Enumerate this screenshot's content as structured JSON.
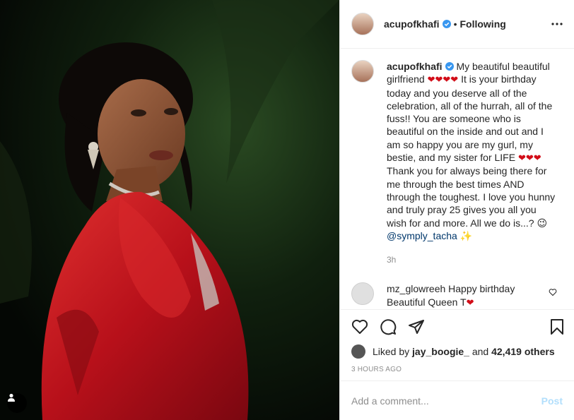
{
  "post": {
    "author": "acupofkhafi",
    "follow_status": "Following",
    "separator": "•"
  },
  "caption": {
    "username": "acupofkhafi",
    "text_1": "My beautiful beautiful girlfriend",
    "hearts_1": "❤❤❤❤",
    "text_2": "It is your birthday today and you deserve all of the celebration, all of the hurrah, all of the fuss!! You are someone who is beautiful on the inside and out and I am so happy you are my gurl, my bestie, and my sister for LIFE",
    "hearts_2": "❤❤❤",
    "text_3": "Thank you for always being there for me through the best times AND through the toughest. I love you hunny and truly pray 25 gives you all you wish for and more. All we do is...?",
    "emoji_wink": "😉",
    "mention": "@symply_tacha",
    "emoji_sparkle": "✨",
    "time": "3h"
  },
  "reply": {
    "username": "mz_glowreeh",
    "text": "Happy birthday Beautiful Queen T",
    "heart": "❤"
  },
  "likes": {
    "prefix": "Liked by",
    "user": "jay_boogie_",
    "and": "and",
    "count": "42,419 others"
  },
  "timestamp": "3 HOURS AGO",
  "comment_box": {
    "placeholder": "Add a comment...",
    "post_label": "Post"
  },
  "icons": [
    "verified-badge",
    "more-icon",
    "heart-icon",
    "comment-icon",
    "share-icon",
    "save-icon",
    "user-tag-icon"
  ],
  "colors": {
    "link": "#00376b",
    "verified": "#3897f0",
    "heart": "#ed4956",
    "post_disabled": "#b2dffc",
    "dress": "#c0121a"
  }
}
